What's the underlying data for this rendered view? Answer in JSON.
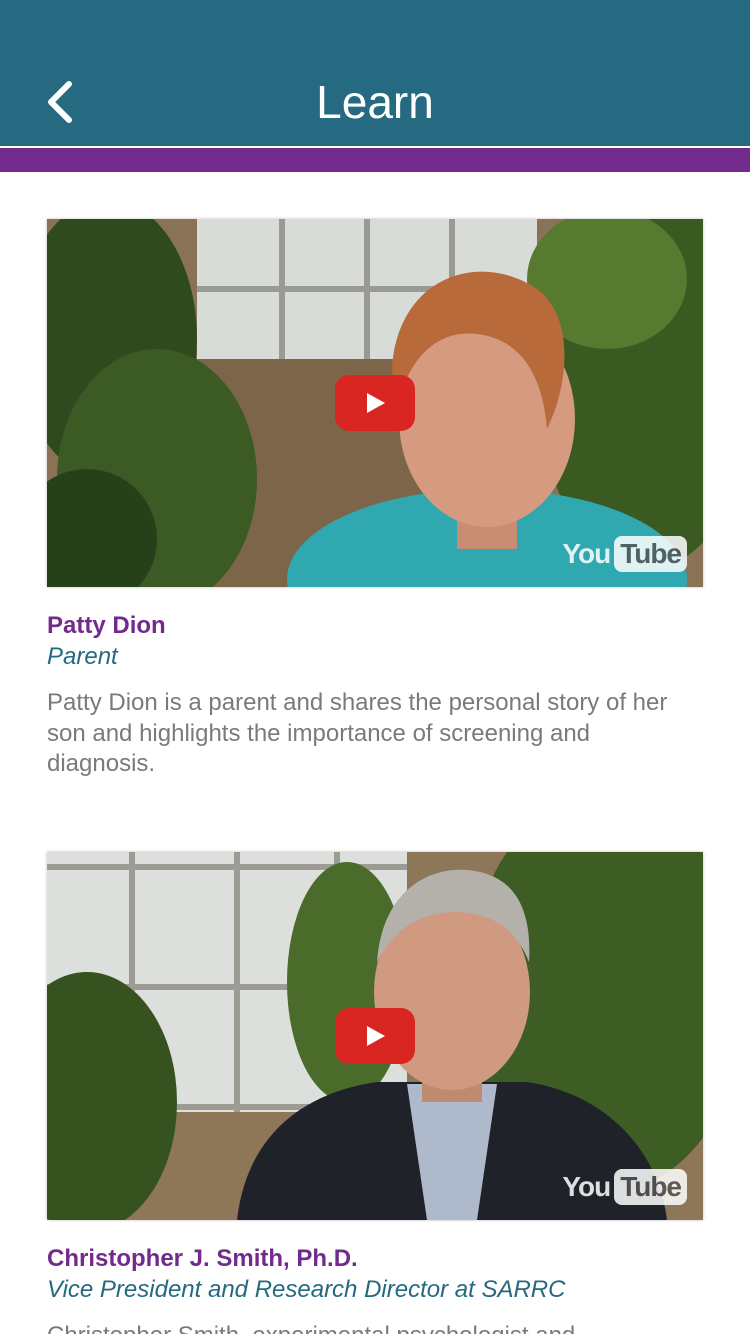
{
  "header": {
    "title": "Learn",
    "back_icon": "chevron-left-icon",
    "bg_color": "#256a80",
    "accent_color": "#732a8d"
  },
  "videos": [
    {
      "name": "Patty Dion",
      "role": "Parent",
      "description": "Patty Dion is a parent and shares the personal story of her son and highlights the importance of screening and diagnosis.",
      "play_icon": "youtube-play-icon",
      "logo": {
        "you": "You",
        "tube": "Tube"
      }
    },
    {
      "name": "Christopher J. Smith, Ph.D.",
      "role": "Vice President and Research Director at SARRC",
      "description": "Christopher Smith, experimental psychologist and",
      "play_icon": "youtube-play-icon",
      "logo": {
        "you": "You",
        "tube": "Tube"
      }
    }
  ]
}
